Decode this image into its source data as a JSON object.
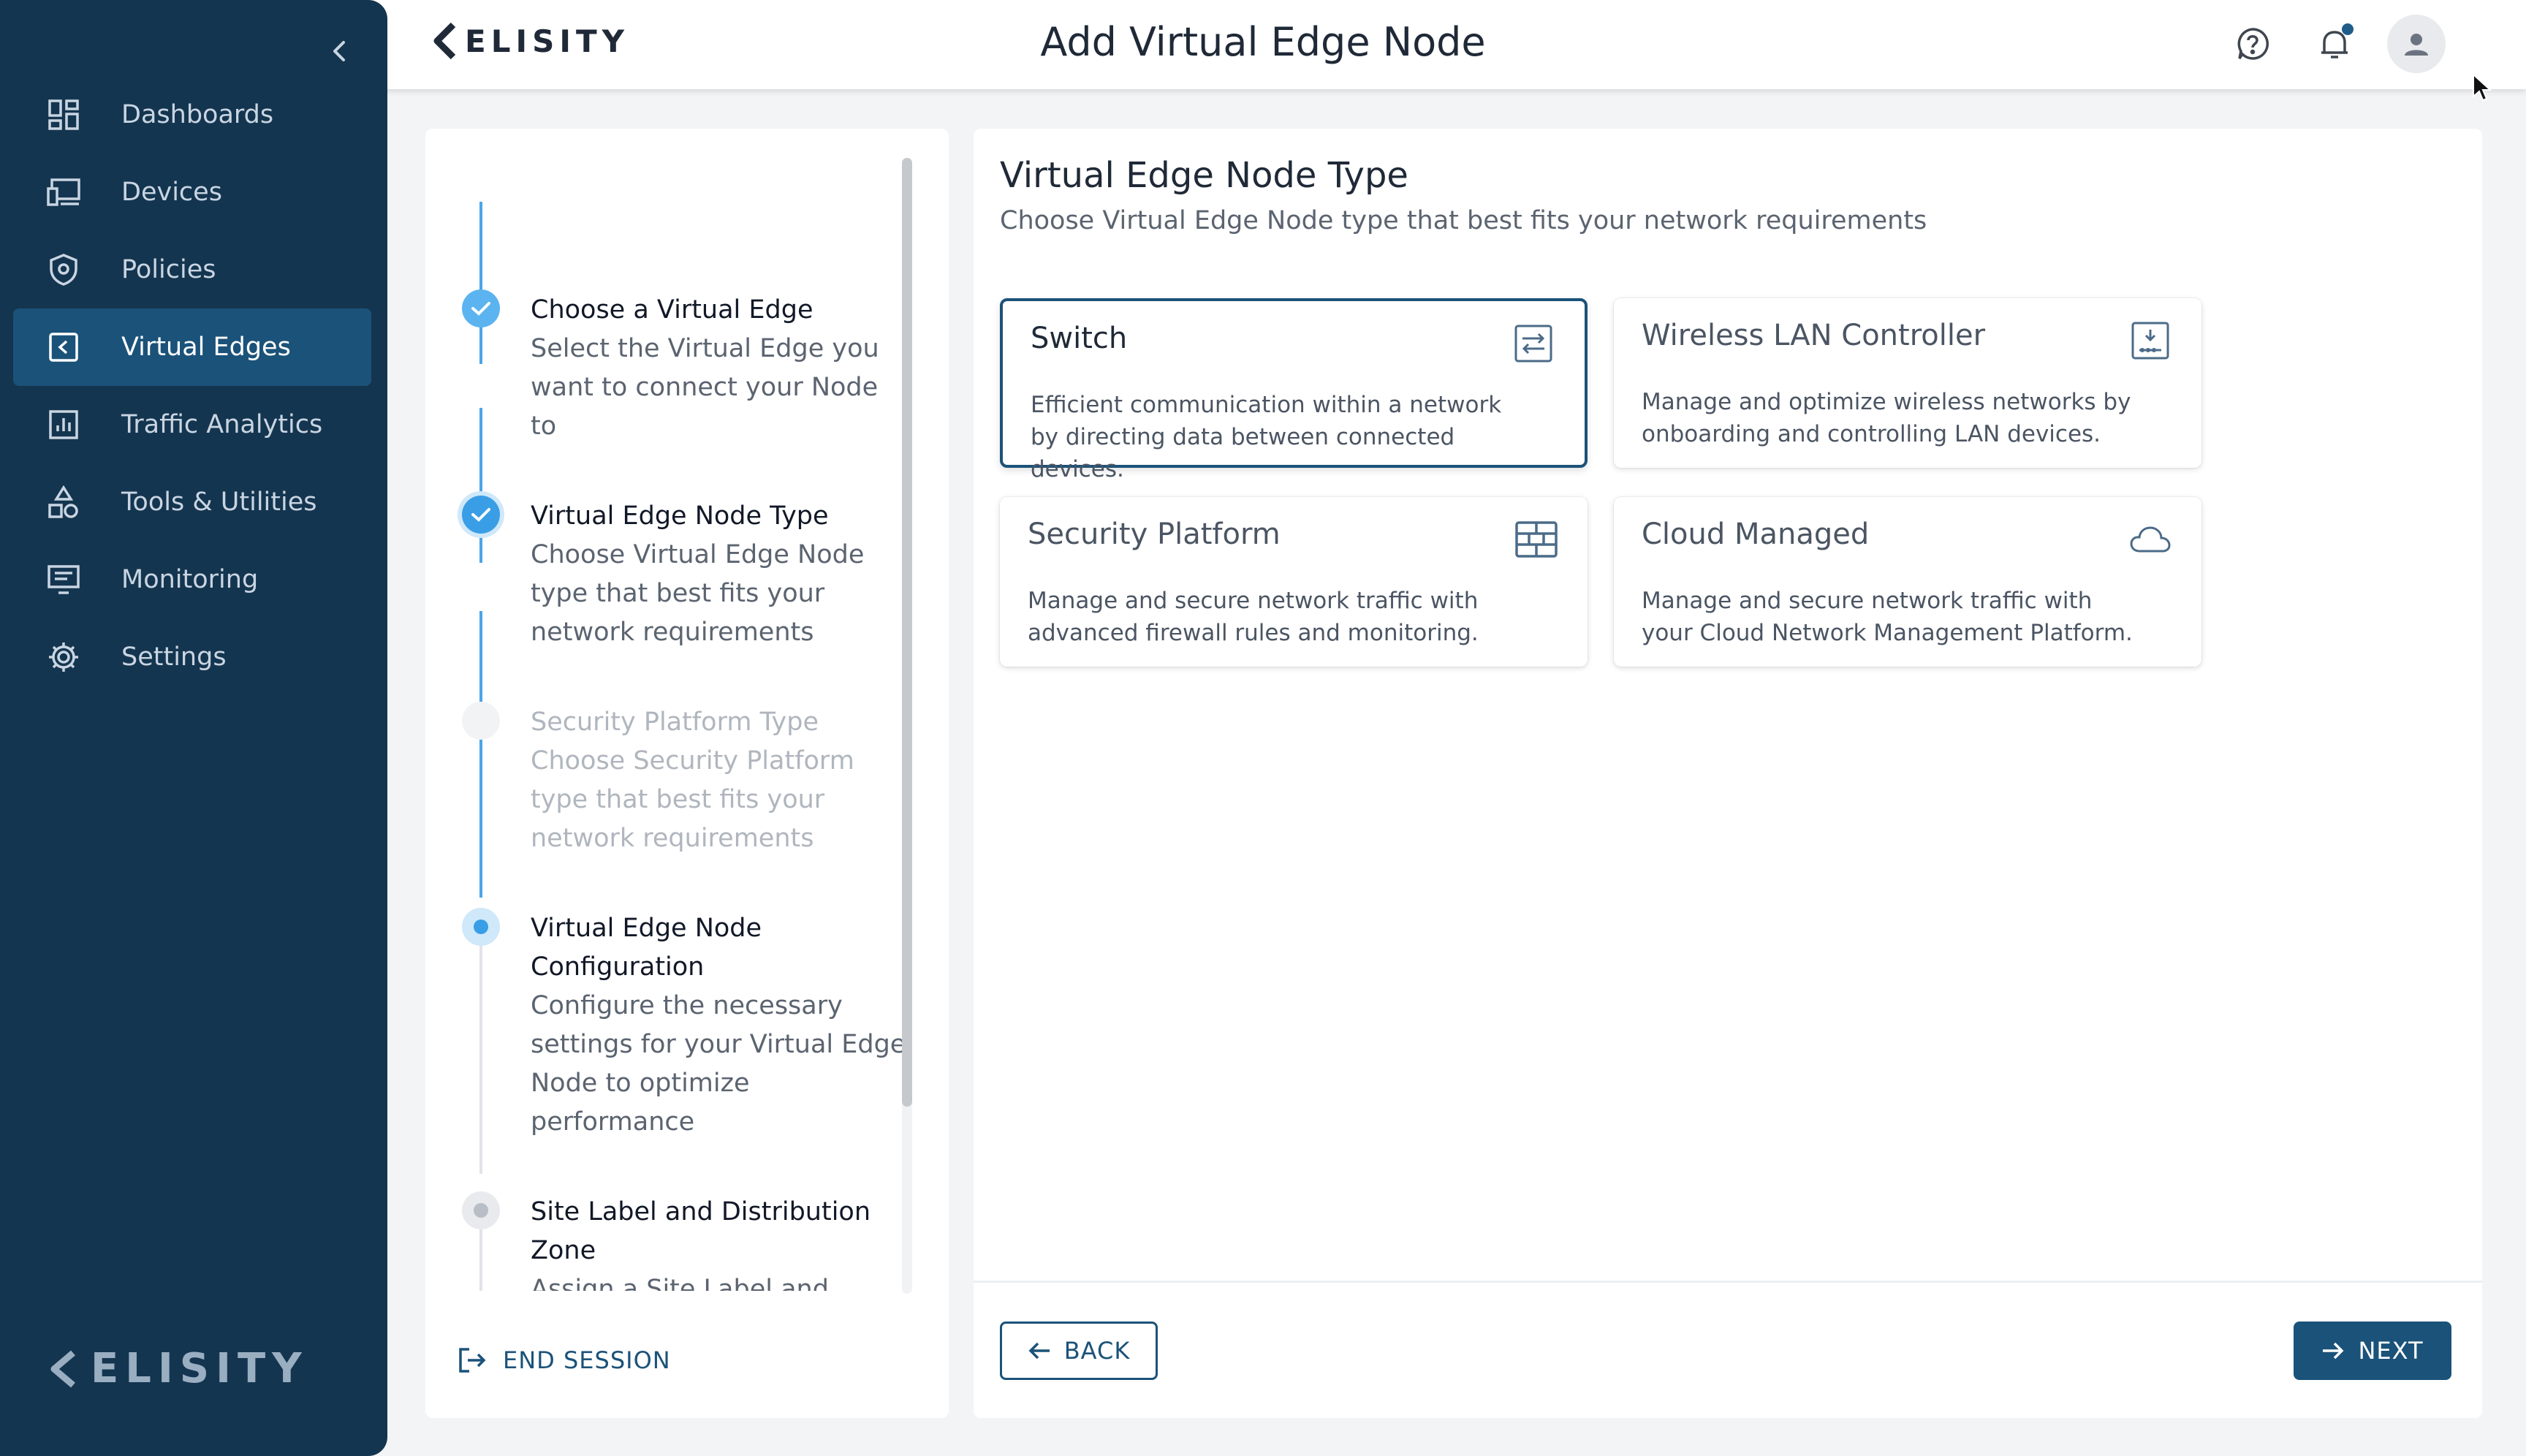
{
  "app": {
    "brand": "ELISITY",
    "page_title": "Add Virtual Edge Node"
  },
  "sidebar": {
    "items": [
      {
        "label": "Dashboards",
        "icon": "dashboard-icon",
        "active": false
      },
      {
        "label": "Devices",
        "icon": "devices-icon",
        "active": false
      },
      {
        "label": "Policies",
        "icon": "shield-icon",
        "active": false
      },
      {
        "label": "Virtual Edges",
        "icon": "virtual-edge-icon",
        "active": true
      },
      {
        "label": "Traffic Analytics",
        "icon": "bar-chart-icon",
        "active": false
      },
      {
        "label": "Tools & Utilities",
        "icon": "shapes-icon",
        "active": false
      },
      {
        "label": "Monitoring",
        "icon": "monitor-icon",
        "active": false
      },
      {
        "label": "Settings",
        "icon": "gear-icon",
        "active": false
      }
    ],
    "logo": "ELISITY"
  },
  "stepper": {
    "steps": [
      {
        "title": "Choose a Virtual Edge",
        "desc": "Select the Virtual Edge you want to connect your Node to",
        "state": "done"
      },
      {
        "title": "Virtual Edge Node Type",
        "desc": "Choose Virtual Edge Node type that best fits your network requirements",
        "state": "done"
      },
      {
        "title": "Security Platform Type",
        "desc": "Choose Security Platform type that best fits your network requirements",
        "state": "disabled"
      },
      {
        "title": "Virtual Edge Node Configuration",
        "desc": "Configure the necessary settings for your Virtual Edge Node to optimize performance",
        "state": "current"
      },
      {
        "title": "Site Label and Distribution Zone",
        "desc": "Assign a Site Label and select a Distribution Zone to deploy your Virtual Edge Node to",
        "state": "pending"
      }
    ],
    "end_session": "END SESSION"
  },
  "main": {
    "title": "Virtual Edge Node Type",
    "subtitle": "Choose Virtual Edge Node type that best fits your network requirements",
    "cards": [
      {
        "title": "Switch",
        "desc": "Efficient communication within a network by directing data between connected devices.",
        "icon": "switch-icon",
        "selected": true
      },
      {
        "title": "Wireless LAN Controller",
        "desc": "Manage and optimize wireless networks by onboarding and controlling LAN devices.",
        "icon": "wlan-controller-icon",
        "selected": false
      },
      {
        "title": "Security Platform",
        "desc": "Manage and secure network traffic with advanced firewall rules and monitoring.",
        "icon": "firewall-icon",
        "selected": false
      },
      {
        "title": "Cloud Managed",
        "desc": "Manage and secure network traffic with your Cloud Network Management Platform.",
        "icon": "cloud-icon",
        "selected": false
      }
    ],
    "back_label": "BACK",
    "next_label": "NEXT"
  },
  "colors": {
    "sidebar_bg": "#14354f",
    "sidebar_active": "#1b5279",
    "primary": "#1b5279",
    "step_done": "#4aa6e8"
  }
}
